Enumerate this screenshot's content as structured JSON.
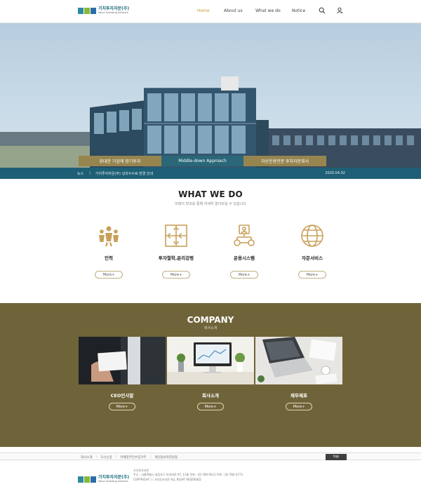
{
  "brand": {
    "name": "가치투자자문(주)",
    "sub": "Value Investing Advisors",
    "block_colors": [
      "#2e8a9e",
      "#88b83a",
      "#2e6ea6"
    ]
  },
  "nav": {
    "items": [
      "Home",
      "About us",
      "What we do",
      "Notice"
    ],
    "active": "Home",
    "accent": "#c79a3c"
  },
  "hero": {
    "tabs": [
      "위대한 기업에 장기투자",
      "Middle-down Approach",
      "자산운용전문 투자자문회사"
    ],
    "tab_colors": [
      "#978550",
      "#2a6778",
      "#978550"
    ],
    "news": {
      "label": "뉴스",
      "title": "가치투자자문(주) 성과수수료 변경 안내",
      "date": "2020.04.02"
    }
  },
  "what_we_do": {
    "title": "WHAT WE DO",
    "subtitle": "미래의 방과를 통해 자세히 알아보실 수 있습니다",
    "items": [
      {
        "label": "인력",
        "icon": "team-icon",
        "more": "More+"
      },
      {
        "label": "투자철학,윤리강령",
        "icon": "puzzle-icon",
        "more": "More+"
      },
      {
        "label": "운용시스템",
        "icon": "network-icon",
        "more": "More+"
      },
      {
        "label": "자문서비스",
        "icon": "globe-icon",
        "more": "More+"
      }
    ],
    "icon_color": "#c9a05a"
  },
  "company": {
    "title": "COMPANY",
    "subtitle": "회사소개",
    "bg_color": "#6f6339",
    "cards": [
      {
        "label": "CEO인사말",
        "more": "More+"
      },
      {
        "label": "회사소개",
        "more": "More+"
      },
      {
        "label": "재무제표",
        "more": "More+"
      }
    ]
  },
  "footer": {
    "links": [
      "회사소개",
      "오시는길",
      "이메일무단수집거부",
      "개인정보처리방침"
    ],
    "top_label": "top",
    "company_name": "가치투자자문",
    "address": "주소 : 서울특별시 영등포구 여의대로 97, 13층 전화 : 02-780-9111 FAX : 02-780-3773",
    "copyright": "COPYRIGHT ⓒ 가치투자자문 ALL RIGHT RESERVED"
  }
}
